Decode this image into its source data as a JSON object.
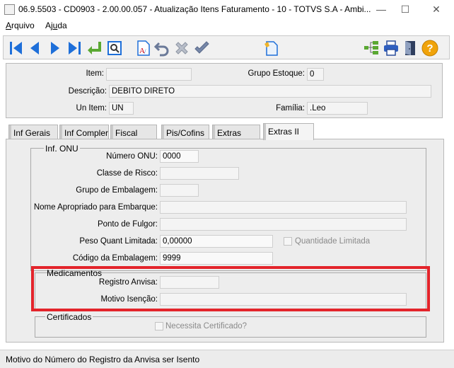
{
  "window": {
    "title": "06.9.5503 - CD0903 - 2.00.00.057 - Atualização Itens Faturamento - 10 - TOTVS S.A - Ambi...",
    "minimize_glyph": "—",
    "maximize_glyph": "☐",
    "close_glyph": "✕"
  },
  "menu": {
    "arquivo_pre": "",
    "arquivo_ul": "A",
    "arquivo_post": "rquivo",
    "ajuda_pre": "Aj",
    "ajuda_ul": "u",
    "ajuda_post": "da"
  },
  "toolbar": {
    "icons": [
      "first-icon",
      "prev-icon",
      "next-icon",
      "last-icon",
      "goto-icon",
      "search-icon",
      "spell-check-icon",
      "undo-icon",
      "cancel-icon",
      "confirm-icon",
      "edit-doc-icon",
      "tree-icon",
      "print-icon",
      "exit-icon",
      "help-icon"
    ],
    "help_glyph": "?"
  },
  "header": {
    "item_label": "Item:",
    "item_value": "",
    "grupo_estoque_label": "Grupo Estoque:",
    "grupo_estoque_value": "0",
    "descricao_label": "Descrição:",
    "descricao_value": "DEBITO DIRETO",
    "un_item_label": "Un Item:",
    "un_item_value": "UN",
    "familia_label": "Família:",
    "familia_value": ".Leo"
  },
  "tabs": [
    "Inf Gerais",
    "Inf Compler",
    "Fiscal",
    "Pis/Cofins",
    "Extras",
    "Extras II"
  ],
  "inf_onu": {
    "title": "Inf. ONU",
    "numero_onu_label": "Número ONU:",
    "numero_onu_value": "0000",
    "classe_risco_label": "Classe de Risco:",
    "classe_risco_value": "",
    "grupo_embalagem_label": "Grupo de Embalagem:",
    "grupo_embalagem_value": "",
    "nome_apropriado_label": "Nome Apropriado para Embarque:",
    "nome_apropriado_value": "",
    "ponto_fulgor_label": "Ponto de Fulgor:",
    "ponto_fulgor_value": "",
    "peso_quant_label": "Peso Quant Limitada:",
    "peso_quant_value": "0,00000",
    "quantidade_limitada_label": "Quantidade Limitada",
    "codigo_embalagem_label": "Código da Embalagem:",
    "codigo_embalagem_value": "9999"
  },
  "medicamentos": {
    "title": "Medicamentos",
    "registro_anvisa_label": "Registro Anvisa:",
    "registro_anvisa_value": "",
    "motivo_isencao_label": "Motivo Isenção:",
    "motivo_isencao_value": ""
  },
  "certificados": {
    "title": "Certificados",
    "necessita_label": "Necessita Certificado?"
  },
  "status": {
    "text": "Motivo do Número do Registro da Anvisa ser Isento"
  },
  "colors": {
    "highlight": "#e3242b",
    "nav_blue": "#1e6fd9",
    "green": "#5aa832",
    "help_orange": "#f0a30a"
  }
}
